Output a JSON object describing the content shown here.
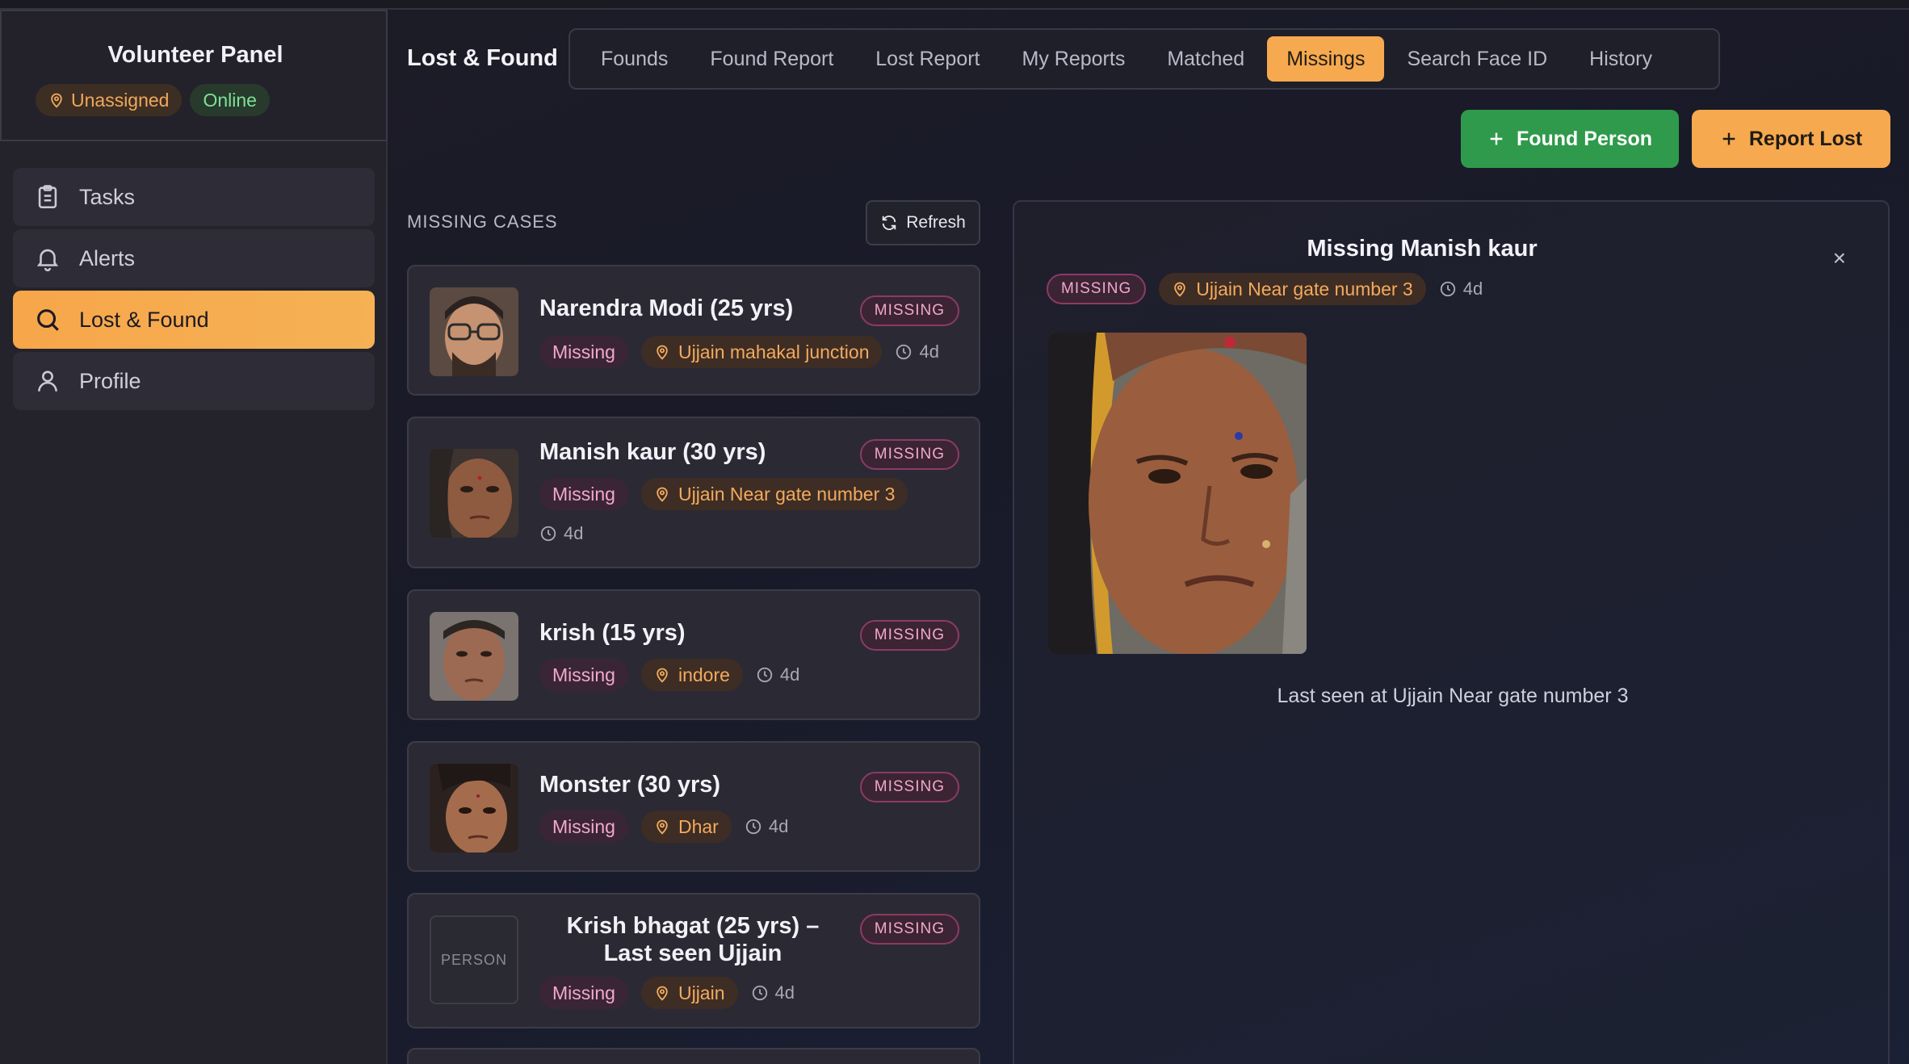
{
  "sidebar": {
    "panel_title": "Volunteer Panel",
    "assignment": "Unassigned",
    "status": "Online",
    "items": [
      {
        "label": "Tasks",
        "icon": "clipboard-icon"
      },
      {
        "label": "Alerts",
        "icon": "bell-icon"
      },
      {
        "label": "Lost & Found",
        "icon": "search-icon",
        "active": true
      },
      {
        "label": "Profile",
        "icon": "user-icon"
      }
    ]
  },
  "header": {
    "title": "Lost & Found",
    "tabs": [
      "Founds",
      "Found Report",
      "Lost Report",
      "My Reports",
      "Matched",
      "Missings",
      "Search Face ID",
      "History"
    ],
    "active_tab": "Missings"
  },
  "actions": {
    "found_person": "Found Person",
    "report_lost": "Report Lost"
  },
  "list": {
    "heading": "MISSING CASES",
    "refresh": "Refresh",
    "cases": [
      {
        "name": "Narendra Modi (25 yrs)",
        "badge": "MISSING",
        "status": "Missing",
        "location": "Ujjain mahakal junction",
        "time": "4d"
      },
      {
        "name": "Manish kaur (30 yrs)",
        "badge": "MISSING",
        "status": "Missing",
        "location": "Ujjain Near gate number 3",
        "time": "4d"
      },
      {
        "name": "krish (15 yrs)",
        "badge": "MISSING",
        "status": "Missing",
        "location": "indore",
        "time": "4d"
      },
      {
        "name": "Monster (30 yrs)",
        "badge": "MISSING",
        "status": "Missing",
        "location": "Dhar",
        "time": "4d"
      },
      {
        "name": "Krish bhagat (25 yrs) – Last seen Ujjain",
        "badge": "MISSING",
        "status": "Missing",
        "location": "Ujjain",
        "time": "4d",
        "photo_placeholder": "PERSON"
      }
    ]
  },
  "detail": {
    "title": "Missing Manish kaur",
    "badge": "MISSING",
    "location": "Ujjain Near gate number 3",
    "time": "4d",
    "close": "×",
    "last_seen": "Last seen at Ujjain Near gate number 3"
  },
  "colors": {
    "accent": "#f6a94e",
    "success": "#2f9a4b",
    "missing": "#f3a7cc"
  }
}
